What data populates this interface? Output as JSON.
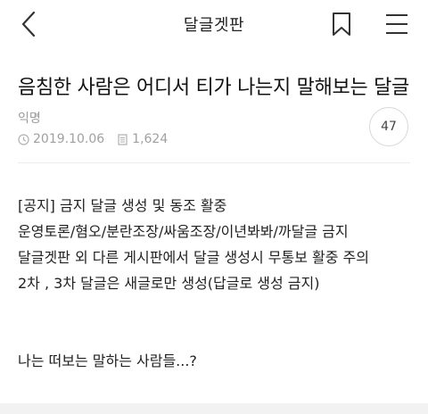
{
  "header": {
    "title": "달글겟판",
    "back_icon": "chevron-left-icon",
    "bookmark_icon": "bookmark-icon",
    "menu_icon": "hamburger-menu-icon"
  },
  "post": {
    "title": "음침한 사람은 어디서 티가 나는지 말해보는 달글",
    "author": "익명",
    "date": "2019.10.06",
    "views": "1,624",
    "comment_count": "47",
    "body_lines": [
      "[공지] 금지 달글 생성 및 동조 활중",
      "운영토론/혐오/분란조장/싸움조장/이년봐봐/까달글 금지",
      "달글겟판 외 다른 게시판에서 달글 생성시 무통보 활중 주의",
      "2차 , 3차 달글은 새글로만 생성(답글로 생성 금지)",
      "나는 떠보는 말하는 사람들...?"
    ]
  },
  "colors": {
    "text_primary": "#222222",
    "text_muted": "#9a9a9a",
    "divider": "#ececec",
    "background": "#ffffff"
  }
}
